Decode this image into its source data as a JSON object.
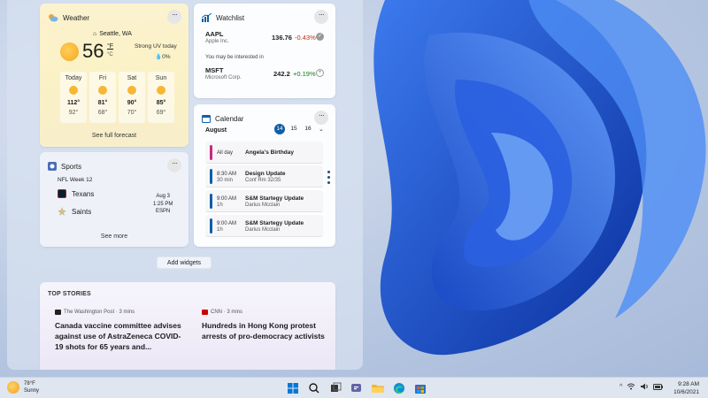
{
  "weather": {
    "title": "Weather",
    "location": "Seattle, WA",
    "temperature": "56",
    "unit_f": "°F",
    "unit_c": "°C",
    "condition": "Strong UV today",
    "precipitation": "0%",
    "days": [
      {
        "name": "Today",
        "high": "112°",
        "low": "92°"
      },
      {
        "name": "Fri",
        "high": "81°",
        "low": "68°"
      },
      {
        "name": "Sat",
        "high": "90°",
        "low": "70°"
      },
      {
        "name": "Sun",
        "high": "85°",
        "low": "69°"
      }
    ],
    "forecast_link": "See full forecast"
  },
  "watchlist": {
    "title": "Watchlist",
    "stocks": [
      {
        "symbol": "AAPL",
        "company": "Apple Inc.",
        "price": "136.76",
        "change": "-0.43%"
      },
      {
        "symbol": "MSFT",
        "company": "Microsoft Corp.",
        "price": "242.2",
        "change": "+0.19%"
      }
    ],
    "interest_label": "You may be interested in"
  },
  "calendar": {
    "title": "Calendar",
    "month": "August",
    "days": [
      "14",
      "15",
      "16"
    ],
    "events": [
      {
        "time": "All day",
        "duration": "",
        "title": "Angela's Birthday",
        "sub": ""
      },
      {
        "time": "8:30 AM",
        "duration": "30 min",
        "title": "Design Update",
        "sub": "Conf Rm 32/35"
      },
      {
        "time": "9:00 AM",
        "duration": "1h",
        "title": "S&M Startegy Update",
        "sub": "Darius Mcclain"
      },
      {
        "time": "9:00 AM",
        "duration": "1h",
        "title": "S&M Startegy Update",
        "sub": "Darius Mcclain"
      }
    ]
  },
  "sports": {
    "title": "Sports",
    "league": "NFL Week 12",
    "team1": "Texans",
    "team2": "Saints",
    "game_date": "Aug 3",
    "game_time": "1:25 PM",
    "game_channel": "ESPN",
    "more_link": "See more"
  },
  "add_widgets": "Add widgets",
  "stories": {
    "title": "TOP STORIES",
    "items": [
      {
        "source": "The Washington Post · 3 mins",
        "headline": "Canada vaccine committee advises against use of AstraZeneca COVID-19 shots for 65 years and..."
      },
      {
        "source": "CNN · 3 mins",
        "headline": "Hundreds in Hong Kong protest arrests of pro-democracy activists"
      }
    ]
  },
  "taskbar": {
    "weather_temp": "78°F",
    "weather_cond": "Sunny",
    "time": "9:28 AM",
    "date": "10/6/2021",
    "tray_chevron": "^"
  },
  "colors": {
    "accent": "#0f5ea8",
    "negative": "#c42b1c",
    "positive": "#107c10",
    "birthday": "#c7287f"
  }
}
